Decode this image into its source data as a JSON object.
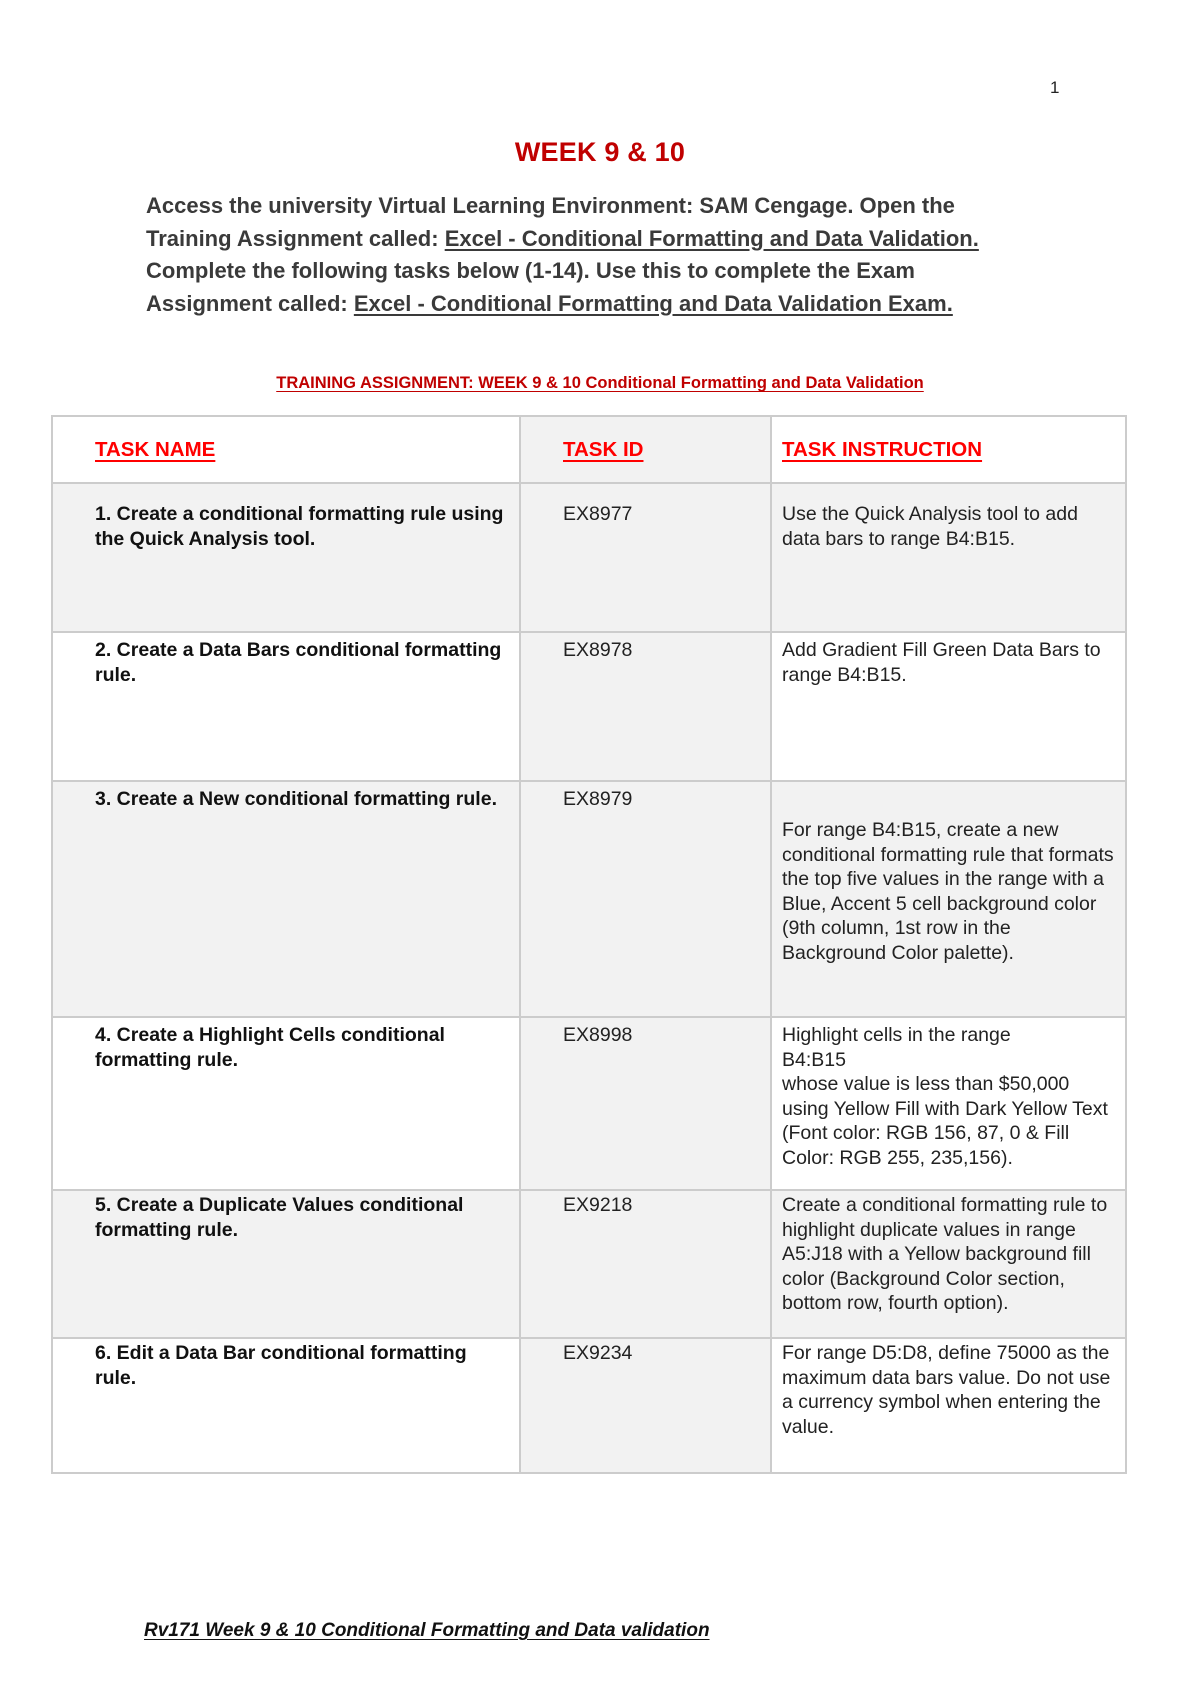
{
  "page": {
    "number": "1",
    "title": "WEEK 9 & 10",
    "title_color": "#c00000",
    "header_color": "#ff0000"
  },
  "intro": {
    "part1": "Access the university Virtual Learning Environment: SAM Cengage. Open the Training Assignment called: ",
    "training_link": "Excel - Conditional Formatting and Data Validation.",
    "part2": " Complete the following tasks below (1-14). Use this to complete the Exam Assignment called: ",
    "exam_link": "Excel - Conditional Formatting and Data Validation Exam."
  },
  "subtitle": "TRAINING ASSIGNMENT: WEEK 9 & 10 Conditional Formatting and Data Validation",
  "table": {
    "headers": {
      "name": "TASK NAME",
      "id": "TASK ID",
      "instruction": "TASK INSTRUCTION"
    },
    "rows": [
      {
        "name": "1. Create a conditional formatting rule using the Quick Analysis tool.",
        "id": "EX8977",
        "instruction": "Use the Quick Analysis tool to add data bars to range B4:B15."
      },
      {
        "name": "2. Create a Data Bars conditional formatting rule.",
        "id": "EX8978",
        "instruction": "Add Gradient Fill Green Data Bars to range B4:B15."
      },
      {
        "name": "3. Create a New conditional formatting rule.",
        "id": "EX8979",
        "instruction": "For range B4:B15, create a new conditional formatting rule that formats the top five values in the range with a Blue, Accent 5 cell background color (9th column, 1st row in the Background Color palette)."
      },
      {
        "name": "4. Create a Highlight Cells conditional formatting rule.",
        "id": "EX8998",
        "instruction_lines": [
          "Highlight cells in the range",
          "B4:B15",
          "whose value is less than $50,000 using Yellow Fill with Dark Yellow Text (Font color: RGB 156, 87, 0 & Fill Color: RGB 255, 235,156)."
        ]
      },
      {
        "name": "5. Create a Duplicate Values conditional formatting rule.",
        "id": "EX9218",
        "instruction": "Create a conditional formatting rule to highlight duplicate values in range A5:J18 with a Yellow background fill color (Background Color section, bottom row, fourth option)."
      },
      {
        "name": "6. Edit a Data Bar conditional formatting rule.",
        "id": "EX9234",
        "instruction": "For range D5:D8, define 75000 as the maximum data bars value. Do not use a currency symbol when entering the value."
      }
    ]
  },
  "footer": "Rv171 Week 9 & 10 Conditional Formatting and Data validation"
}
